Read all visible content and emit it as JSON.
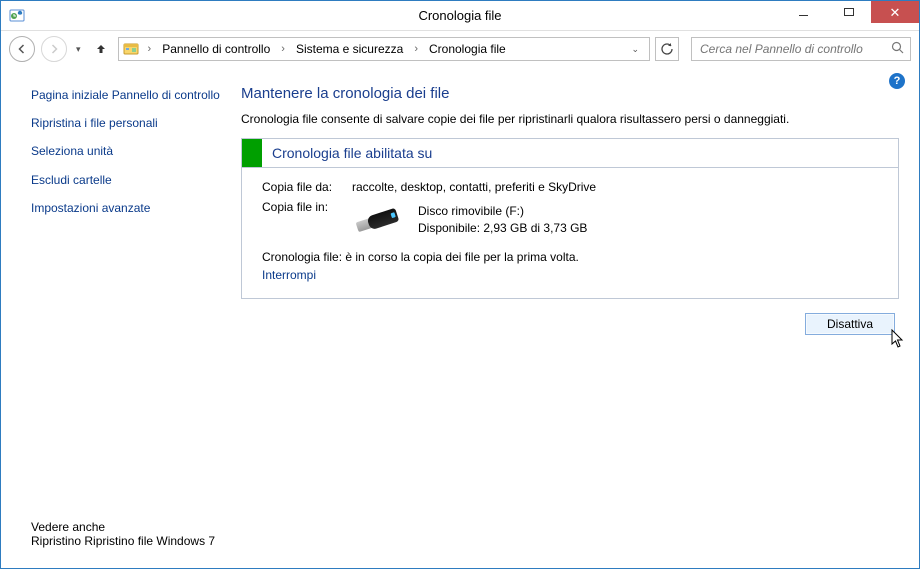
{
  "window": {
    "title": "Cronologia file"
  },
  "breadcrumb": {
    "item1": "Pannello di controllo",
    "item2": "Sistema e sicurezza",
    "item3": "Cronologia file"
  },
  "search": {
    "placeholder": "Cerca nel Pannello di controllo"
  },
  "sidebar": {
    "home": "Pagina iniziale Pannello di controllo",
    "restore": "Ripristina i file personali",
    "select_drive": "Seleziona unità",
    "exclude": "Escludi cartelle",
    "advanced": "Impostazioni avanzate",
    "see_also_header": "Vedere anche",
    "see_also_1": "Ripristino",
    "see_also_2": "Ripristino file Windows 7"
  },
  "main": {
    "heading": "Mantenere la cronologia dei file",
    "description": "Cronologia file consente di salvare copie dei file per ripristinarli qualora risultassero persi o danneggiati.",
    "status_title": "Cronologia file abilitata su",
    "copy_from_label": "Copia file da:",
    "copy_from_value": "raccolte, desktop, contatti, preferiti e SkyDrive",
    "copy_to_label": "Copia file in:",
    "dest_name": "Disco rimovibile (F:)",
    "dest_space": "Disponibile: 2,93 GB di 3,73 GB",
    "copying_status": "Cronologia file: è in corso la copia dei file per la prima volta.",
    "interrupt": "Interrompi",
    "turnoff_btn": "Disattiva"
  }
}
